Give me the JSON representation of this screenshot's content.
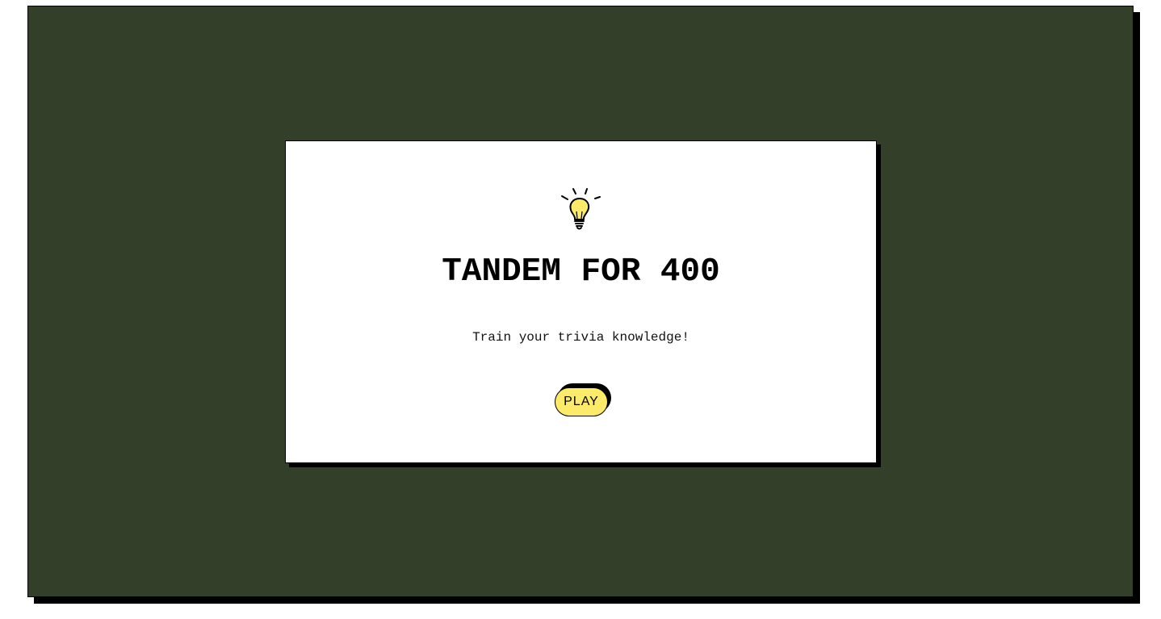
{
  "colors": {
    "background": "#333f28",
    "card": "#ffffff",
    "accent": "#fcea6a",
    "shadow": "#000000"
  },
  "hero": {
    "icon": "lightbulb-icon",
    "title": "TANDEM FOR 400",
    "subtitle": "Train your trivia knowledge!",
    "play_label": "PLAY"
  }
}
